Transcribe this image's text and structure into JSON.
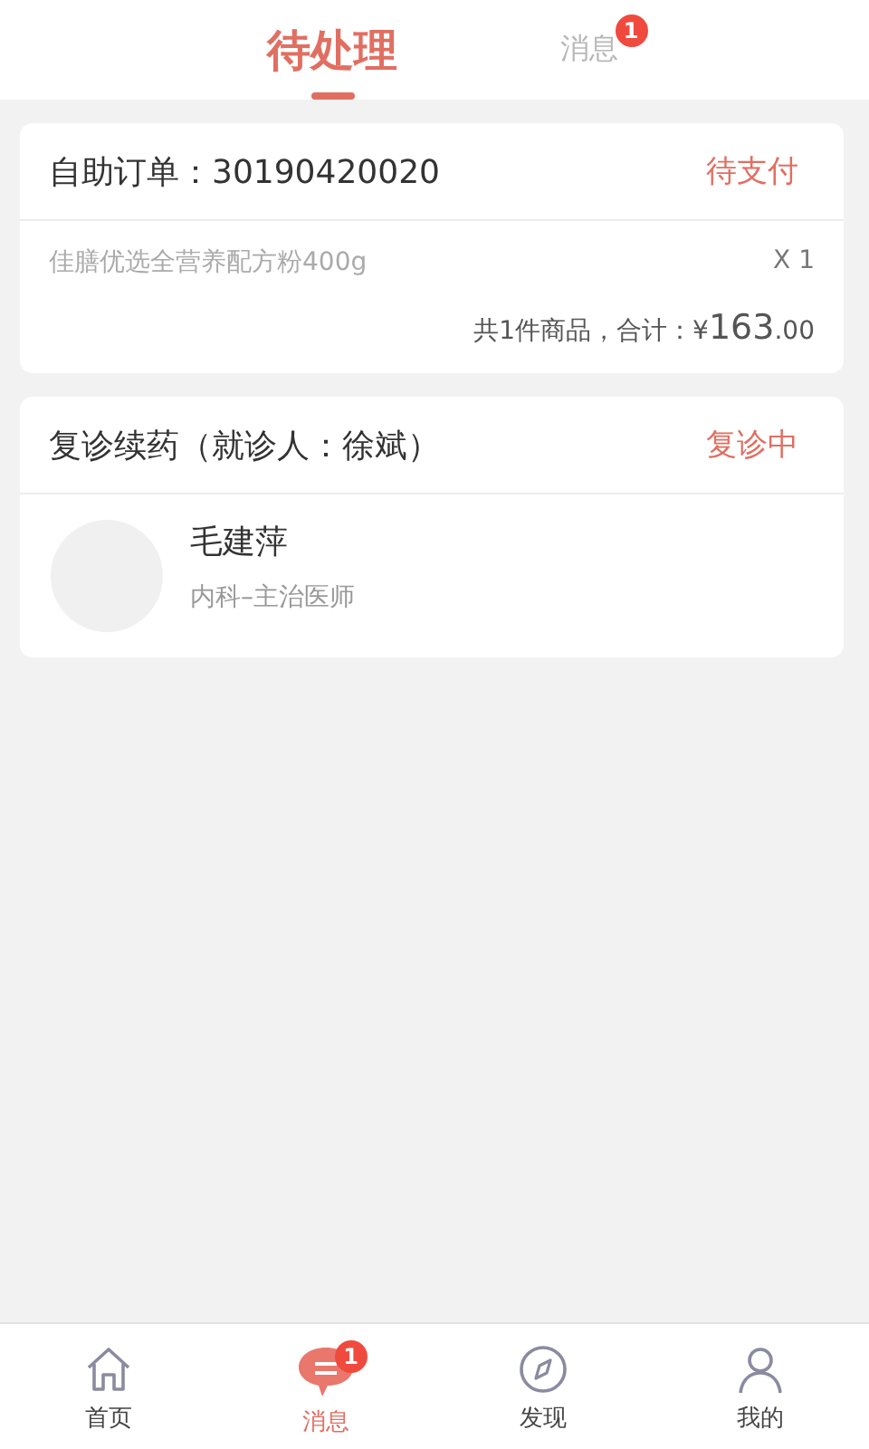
{
  "top_tabs": [
    {
      "label": "待处理",
      "selected": true
    },
    {
      "label": "消息",
      "selected": false,
      "badge": "1"
    }
  ],
  "order_card": {
    "title": "自助订单：30190420020",
    "status": "待支付",
    "item_name": "佳膳优选全营养配方粉400g",
    "quantity": "X 1",
    "summary": "共1件商品，合计：",
    "currency": "¥",
    "amount": "163",
    "cents": ".00"
  },
  "consult_card": {
    "title": "复诊续药（就诊人：徐斌）",
    "status": "复诊中",
    "doctor_name": "毛建萍",
    "doctor_title": "内科–主治医师"
  },
  "bottom_nav": [
    {
      "kind": "home",
      "label": "首页",
      "selected": false
    },
    {
      "kind": "message",
      "label": "消息",
      "selected": true,
      "badge": "1"
    },
    {
      "kind": "discover",
      "label": "发现",
      "selected": false
    },
    {
      "kind": "profile",
      "label": "我的",
      "selected": false
    }
  ]
}
